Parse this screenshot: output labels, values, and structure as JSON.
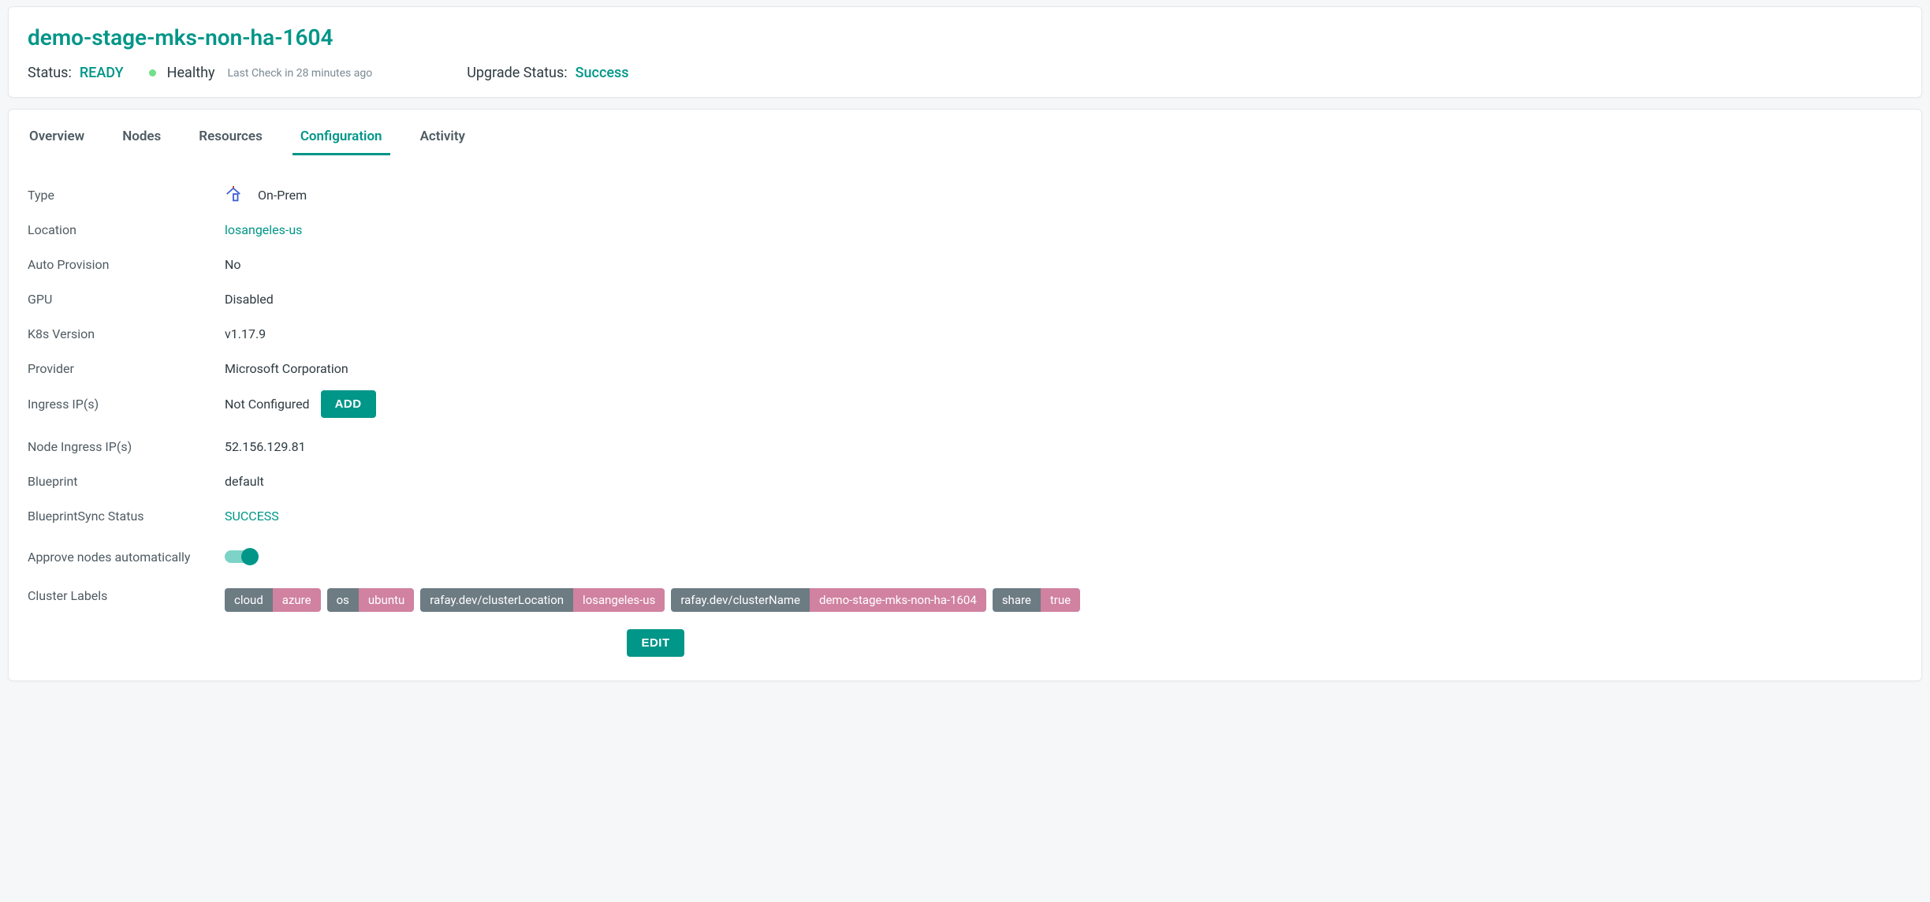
{
  "header": {
    "title": "demo-stage-mks-non-ha-1604",
    "status_label": "Status:",
    "status_value": "READY",
    "health": "Healthy",
    "last_check": "Last Check in 28 minutes ago",
    "upgrade_label": "Upgrade Status:",
    "upgrade_value": "Success"
  },
  "tabs": [
    {
      "label": "Overview"
    },
    {
      "label": "Nodes"
    },
    {
      "label": "Resources"
    },
    {
      "label": "Configuration"
    },
    {
      "label": "Activity"
    }
  ],
  "active_tab": "Configuration",
  "config": {
    "type_label": "Type",
    "type_value": "On-Prem",
    "location_label": "Location",
    "location_value": "losangeles-us",
    "auto_provision_label": "Auto Provision",
    "auto_provision_value": "No",
    "gpu_label": "GPU",
    "gpu_value": "Disabled",
    "k8s_label": "K8s Version",
    "k8s_value": "v1.17.9",
    "provider_label": "Provider",
    "provider_value": "Microsoft Corporation",
    "ingress_label": "Ingress IP(s)",
    "ingress_value": "Not Configured",
    "ingress_add_btn": "ADD",
    "node_ingress_label": "Node Ingress IP(s)",
    "node_ingress_value": "52.156.129.81",
    "blueprint_label": "Blueprint",
    "blueprint_value": "default",
    "blueprint_sync_label": "BlueprintSync Status",
    "blueprint_sync_value": "SUCCESS",
    "approve_label": "Approve nodes automatically",
    "approve_value": true,
    "cluster_labels_label": "Cluster Labels",
    "cluster_labels": [
      {
        "k": "cloud",
        "v": "azure"
      },
      {
        "k": "os",
        "v": "ubuntu"
      },
      {
        "k": "rafay.dev/clusterLocation",
        "v": "losangeles-us"
      },
      {
        "k": "rafay.dev/clusterName",
        "v": "demo-stage-mks-non-ha-1604"
      },
      {
        "k": "share",
        "v": "true"
      }
    ],
    "edit_btn": "EDIT"
  }
}
